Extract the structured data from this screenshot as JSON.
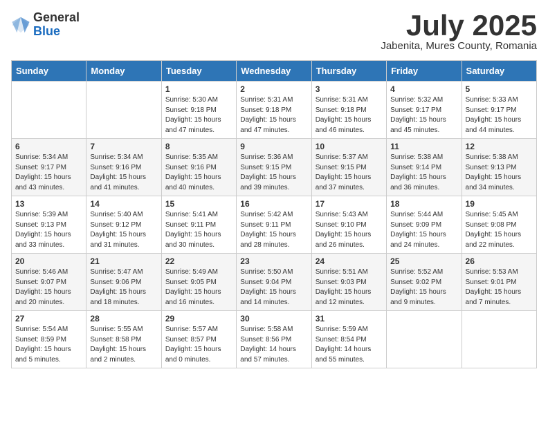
{
  "logo": {
    "general": "General",
    "blue": "Blue"
  },
  "title": "July 2025",
  "subtitle": "Jabenita, Mures County, Romania",
  "weekdays": [
    "Sunday",
    "Monday",
    "Tuesday",
    "Wednesday",
    "Thursday",
    "Friday",
    "Saturday"
  ],
  "weeks": [
    [
      {
        "day": "",
        "info": ""
      },
      {
        "day": "",
        "info": ""
      },
      {
        "day": "1",
        "info": "Sunrise: 5:30 AM\nSunset: 9:18 PM\nDaylight: 15 hours and 47 minutes."
      },
      {
        "day": "2",
        "info": "Sunrise: 5:31 AM\nSunset: 9:18 PM\nDaylight: 15 hours and 47 minutes."
      },
      {
        "day": "3",
        "info": "Sunrise: 5:31 AM\nSunset: 9:18 PM\nDaylight: 15 hours and 46 minutes."
      },
      {
        "day": "4",
        "info": "Sunrise: 5:32 AM\nSunset: 9:17 PM\nDaylight: 15 hours and 45 minutes."
      },
      {
        "day": "5",
        "info": "Sunrise: 5:33 AM\nSunset: 9:17 PM\nDaylight: 15 hours and 44 minutes."
      }
    ],
    [
      {
        "day": "6",
        "info": "Sunrise: 5:34 AM\nSunset: 9:17 PM\nDaylight: 15 hours and 43 minutes."
      },
      {
        "day": "7",
        "info": "Sunrise: 5:34 AM\nSunset: 9:16 PM\nDaylight: 15 hours and 41 minutes."
      },
      {
        "day": "8",
        "info": "Sunrise: 5:35 AM\nSunset: 9:16 PM\nDaylight: 15 hours and 40 minutes."
      },
      {
        "day": "9",
        "info": "Sunrise: 5:36 AM\nSunset: 9:15 PM\nDaylight: 15 hours and 39 minutes."
      },
      {
        "day": "10",
        "info": "Sunrise: 5:37 AM\nSunset: 9:15 PM\nDaylight: 15 hours and 37 minutes."
      },
      {
        "day": "11",
        "info": "Sunrise: 5:38 AM\nSunset: 9:14 PM\nDaylight: 15 hours and 36 minutes."
      },
      {
        "day": "12",
        "info": "Sunrise: 5:38 AM\nSunset: 9:13 PM\nDaylight: 15 hours and 34 minutes."
      }
    ],
    [
      {
        "day": "13",
        "info": "Sunrise: 5:39 AM\nSunset: 9:13 PM\nDaylight: 15 hours and 33 minutes."
      },
      {
        "day": "14",
        "info": "Sunrise: 5:40 AM\nSunset: 9:12 PM\nDaylight: 15 hours and 31 minutes."
      },
      {
        "day": "15",
        "info": "Sunrise: 5:41 AM\nSunset: 9:11 PM\nDaylight: 15 hours and 30 minutes."
      },
      {
        "day": "16",
        "info": "Sunrise: 5:42 AM\nSunset: 9:11 PM\nDaylight: 15 hours and 28 minutes."
      },
      {
        "day": "17",
        "info": "Sunrise: 5:43 AM\nSunset: 9:10 PM\nDaylight: 15 hours and 26 minutes."
      },
      {
        "day": "18",
        "info": "Sunrise: 5:44 AM\nSunset: 9:09 PM\nDaylight: 15 hours and 24 minutes."
      },
      {
        "day": "19",
        "info": "Sunrise: 5:45 AM\nSunset: 9:08 PM\nDaylight: 15 hours and 22 minutes."
      }
    ],
    [
      {
        "day": "20",
        "info": "Sunrise: 5:46 AM\nSunset: 9:07 PM\nDaylight: 15 hours and 20 minutes."
      },
      {
        "day": "21",
        "info": "Sunrise: 5:47 AM\nSunset: 9:06 PM\nDaylight: 15 hours and 18 minutes."
      },
      {
        "day": "22",
        "info": "Sunrise: 5:49 AM\nSunset: 9:05 PM\nDaylight: 15 hours and 16 minutes."
      },
      {
        "day": "23",
        "info": "Sunrise: 5:50 AM\nSunset: 9:04 PM\nDaylight: 15 hours and 14 minutes."
      },
      {
        "day": "24",
        "info": "Sunrise: 5:51 AM\nSunset: 9:03 PM\nDaylight: 15 hours and 12 minutes."
      },
      {
        "day": "25",
        "info": "Sunrise: 5:52 AM\nSunset: 9:02 PM\nDaylight: 15 hours and 9 minutes."
      },
      {
        "day": "26",
        "info": "Sunrise: 5:53 AM\nSunset: 9:01 PM\nDaylight: 15 hours and 7 minutes."
      }
    ],
    [
      {
        "day": "27",
        "info": "Sunrise: 5:54 AM\nSunset: 8:59 PM\nDaylight: 15 hours and 5 minutes."
      },
      {
        "day": "28",
        "info": "Sunrise: 5:55 AM\nSunset: 8:58 PM\nDaylight: 15 hours and 2 minutes."
      },
      {
        "day": "29",
        "info": "Sunrise: 5:57 AM\nSunset: 8:57 PM\nDaylight: 15 hours and 0 minutes."
      },
      {
        "day": "30",
        "info": "Sunrise: 5:58 AM\nSunset: 8:56 PM\nDaylight: 14 hours and 57 minutes."
      },
      {
        "day": "31",
        "info": "Sunrise: 5:59 AM\nSunset: 8:54 PM\nDaylight: 14 hours and 55 minutes."
      },
      {
        "day": "",
        "info": ""
      },
      {
        "day": "",
        "info": ""
      }
    ]
  ]
}
